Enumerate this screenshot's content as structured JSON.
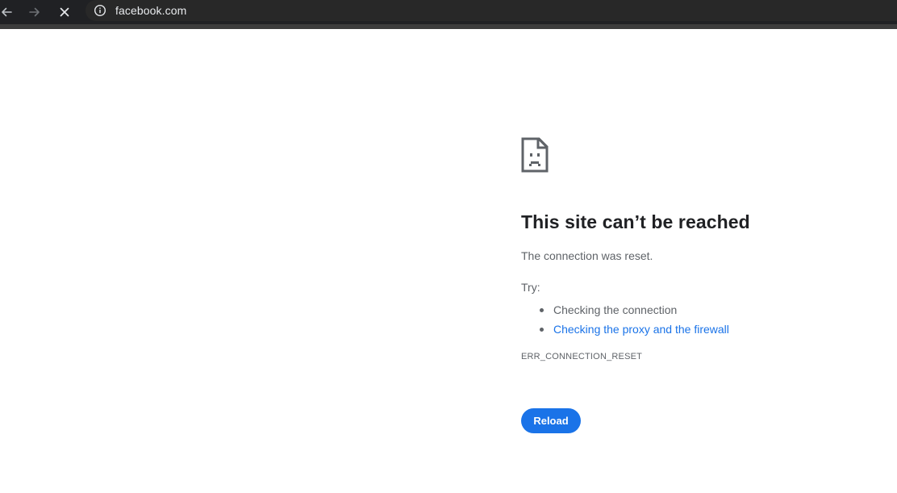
{
  "browser": {
    "url": "facebook.com",
    "icons": {
      "back": "arrow-left-icon",
      "forward": "arrow-right-icon",
      "stop": "close-icon",
      "site_info": "info-icon"
    }
  },
  "error_page": {
    "icon": "sad-page-icon",
    "title": "This site can’t be reached",
    "description": "The connection was reset.",
    "try_label": "Try:",
    "suggestions": [
      {
        "label": "Checking the connection",
        "is_link": false
      },
      {
        "label": "Checking the proxy and the firewall",
        "is_link": true
      }
    ],
    "error_code": "ERR_CONNECTION_RESET",
    "reload_label": "Reload"
  },
  "colors": {
    "toolbar_bg": "#202124",
    "link": "#1a73e8",
    "button_bg": "#1a73e8",
    "title_text": "#202124",
    "body_text": "#5f6368"
  }
}
